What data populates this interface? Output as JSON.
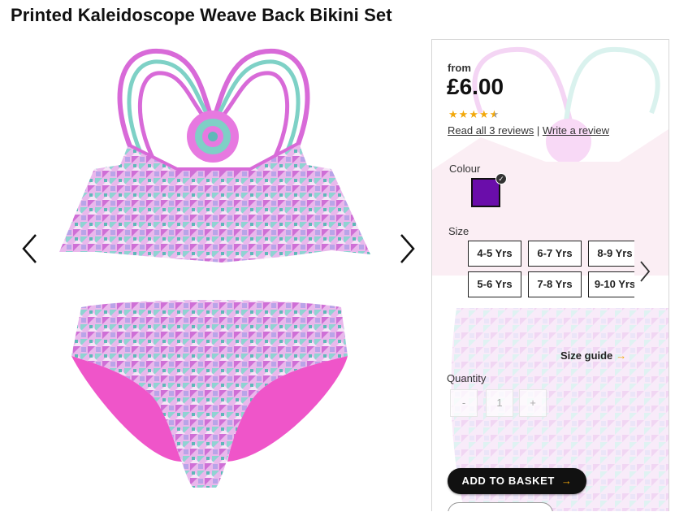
{
  "product": {
    "title": "Printed Kaleidoscope Weave Back Bikini Set"
  },
  "gallery": {
    "prev_icon": "chevron-left-icon",
    "next_icon": "chevron-right-icon"
  },
  "panel": {
    "from_label": "from",
    "price": "£6.00",
    "rating": 4.5,
    "rating_max": 5,
    "read_reviews": "Read all 3 reviews",
    "separator": "|",
    "write_review": "Write a review",
    "colour_label": "Colour",
    "selected_colour": "#6a0daa",
    "size_label": "Size",
    "sizes_row1": [
      "4-5 Yrs",
      "6-7 Yrs",
      "8-9 Yrs"
    ],
    "sizes_row2": [
      "5-6 Yrs",
      "7-8 Yrs",
      "9-10 Yrs"
    ],
    "size_guide": "Size guide",
    "quantity_label": "Quantity",
    "qty_minus": "-",
    "qty_value": "1",
    "qty_plus": "+",
    "add_to_basket": "ADD TO BASKET",
    "accent": "#f2a80a"
  }
}
